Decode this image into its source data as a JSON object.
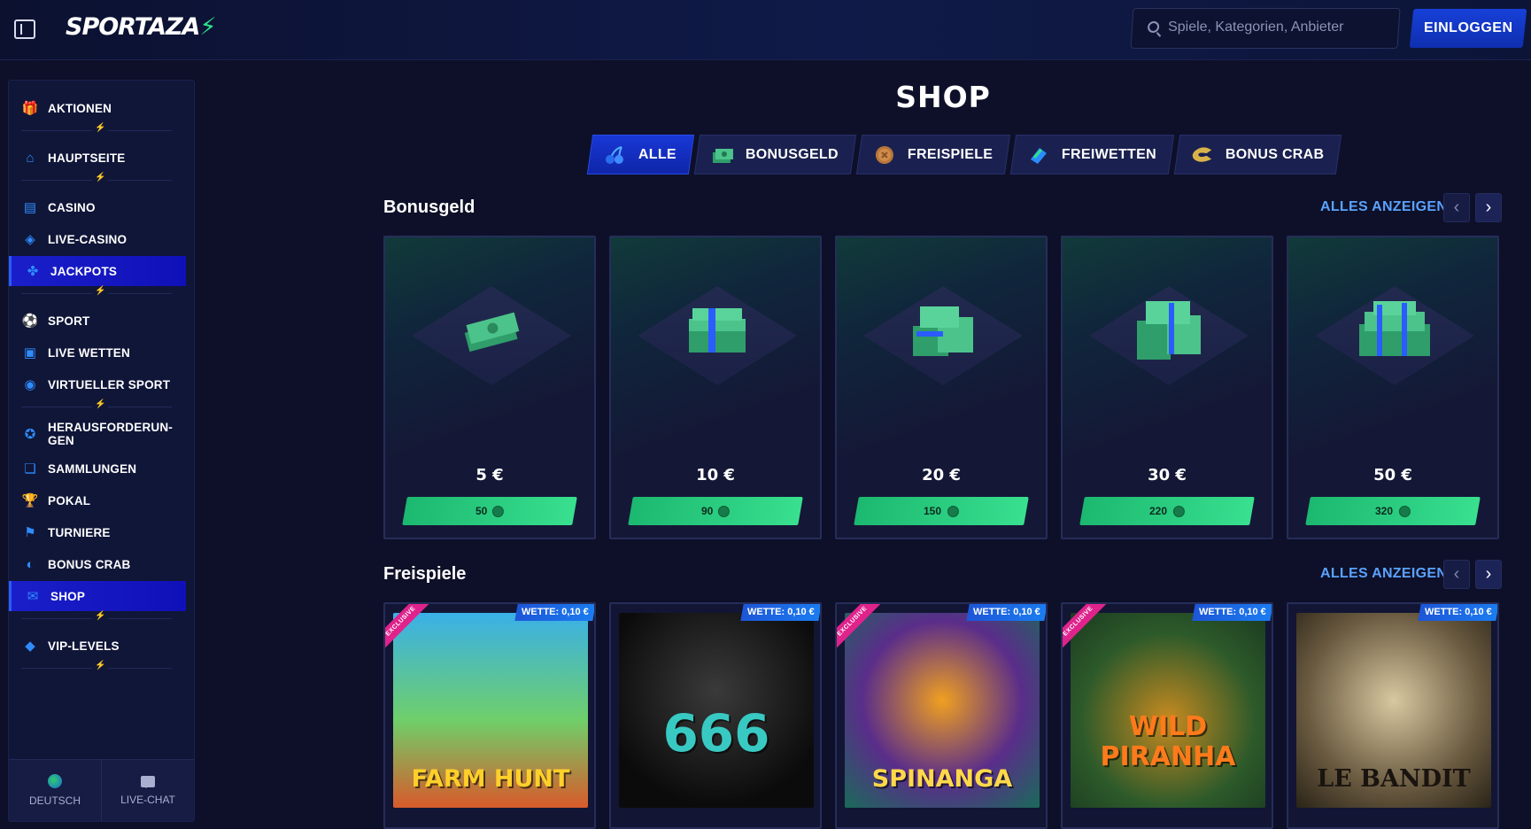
{
  "header": {
    "logo_text": "SPORTAZA",
    "search_placeholder": "Spiele, Kategorien, Anbieter",
    "login_label": "EINLOGGEN"
  },
  "sidebar": {
    "items": [
      {
        "label": "AKTIONEN",
        "icon": "gift-icon"
      },
      {
        "label": "HAUPTSEITE",
        "icon": "home-icon"
      },
      {
        "label": "CASINO",
        "icon": "slot-machine-icon"
      },
      {
        "label": "LIVE-CASINO",
        "icon": "card-icon"
      },
      {
        "label": "JACKPOTS",
        "icon": "clover-icon",
        "active": true
      },
      {
        "label": "SPORT",
        "icon": "soccer-ball-icon"
      },
      {
        "label": "LIVE WETTEN",
        "icon": "live-icon"
      },
      {
        "label": "VIRTUELLER SPORT",
        "icon": "virtual-sport-icon"
      },
      {
        "label": "HERAUSFORDERUN-GEN",
        "icon": "medal-icon"
      },
      {
        "label": "SAMMLUNGEN",
        "icon": "collection-icon"
      },
      {
        "label": "POKAL",
        "icon": "trophy-icon"
      },
      {
        "label": "TURNIERE",
        "icon": "checkered-flag-icon"
      },
      {
        "label": "BONUS CRAB",
        "icon": "crab-icon"
      },
      {
        "label": "SHOP",
        "icon": "shop-icon",
        "active": true
      },
      {
        "label": "VIP-LEVELS",
        "icon": "diamond-icon"
      }
    ],
    "footer": {
      "language_label": "DEUTSCH",
      "chat_label": "LIVE-CHAT"
    }
  },
  "main": {
    "title": "SHOP",
    "tabs": [
      {
        "label": "ALLE",
        "icon": "cherries-icon",
        "active": true
      },
      {
        "label": "BONUSGELD",
        "icon": "cash-icon"
      },
      {
        "label": "FREISPIELE",
        "icon": "coin-icon"
      },
      {
        "label": "FREIWETTEN",
        "icon": "ticket-icon"
      },
      {
        "label": "BONUS CRAB",
        "icon": "crab-claw-icon"
      }
    ],
    "bonus_section": {
      "title": "Bonusgeld",
      "see_all": "ALLES ANZEIGEN",
      "items": [
        {
          "price": "5 €",
          "cost": "50"
        },
        {
          "price": "10 €",
          "cost": "90"
        },
        {
          "price": "20 €",
          "cost": "150"
        },
        {
          "price": "30 €",
          "cost": "220"
        },
        {
          "price": "50 €",
          "cost": "320"
        }
      ]
    },
    "spins_section": {
      "title": "Freispiele",
      "see_all": "ALLES ANZEIGEN",
      "items": [
        {
          "name": "FARM HUNT",
          "bet": "WETTE: 0,10 €",
          "exclusive": "EXCLUSIVE"
        },
        {
          "name": "666",
          "bet": "WETTE: 0,10 €"
        },
        {
          "name": "SPINANGA",
          "bet": "WETTE: 0,10 €",
          "exclusive": "EXCLUSIVE"
        },
        {
          "name": "WILD PIRANHA",
          "bet": "WETTE: 0,10 €",
          "exclusive": "EXCLUSIVE"
        },
        {
          "name": "LE BANDIT",
          "bet": "WETTE: 0,10 €"
        }
      ]
    }
  },
  "colors": {
    "background": "#0d1028",
    "accent_blue": "#1837d6",
    "accent_green": "#2de38a",
    "link_blue": "#5aa2ff"
  }
}
